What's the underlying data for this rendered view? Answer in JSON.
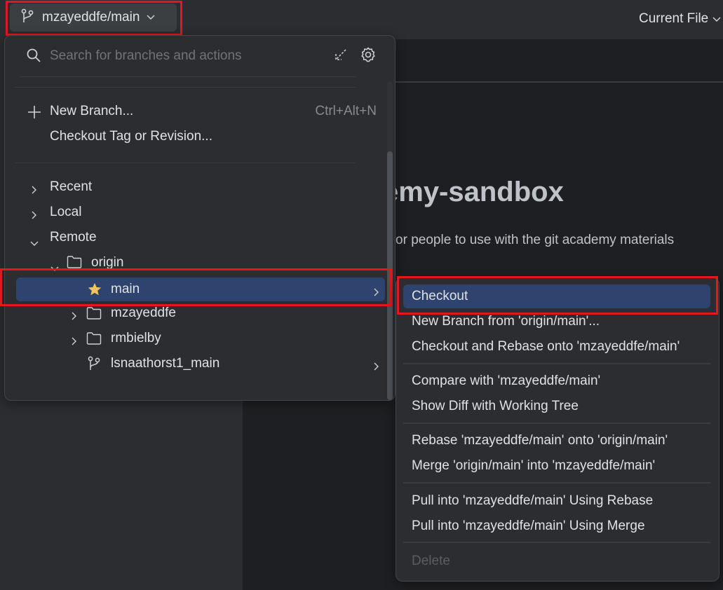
{
  "toolbar": {
    "branch_widget": {
      "label": "mzayeddfe/main",
      "icon": "git-branch-icon"
    },
    "run_config": {
      "label": "Current File"
    }
  },
  "editor": {
    "readme_title_partial": "emy-sandbox",
    "readme_text_partial": "y for people to use with the git academy materials"
  },
  "branch_popup": {
    "search": {
      "placeholder": "Search for branches and actions",
      "value": ""
    },
    "actions": [
      {
        "label": "New Branch...",
        "shortcut": "Ctrl+Alt+N",
        "icon": "plus-icon"
      },
      {
        "label": "Checkout Tag or Revision..."
      }
    ],
    "tree": [
      {
        "label": "Recent",
        "expanded": false,
        "level": 0
      },
      {
        "label": "Local",
        "expanded": false,
        "level": 0
      },
      {
        "label": "Remote",
        "expanded": true,
        "level": 0
      },
      {
        "label": "origin",
        "expanded": true,
        "level": 1,
        "icon": "folder-icon"
      },
      {
        "label": "main",
        "level": 2,
        "icon": "star-icon",
        "selected": true,
        "has_submenu": true
      },
      {
        "label": "mzayeddfe",
        "expanded": false,
        "level": 2,
        "icon": "folder-icon"
      },
      {
        "label": "rmbielby",
        "expanded": false,
        "level": 2,
        "icon": "folder-icon"
      },
      {
        "label": "lsnaathorst1_main",
        "level": 2,
        "icon": "git-branch-icon",
        "has_submenu": true
      }
    ]
  },
  "submenu": {
    "groups": [
      [
        {
          "label": "Checkout",
          "active": true
        },
        {
          "label": "New Branch from 'origin/main'..."
        },
        {
          "label": "Checkout and Rebase onto 'mzayeddfe/main'"
        }
      ],
      [
        {
          "label": "Compare with 'mzayeddfe/main'"
        },
        {
          "label": "Show Diff with Working Tree"
        }
      ],
      [
        {
          "label": "Rebase 'mzayeddfe/main' onto 'origin/main'"
        },
        {
          "label": "Merge 'origin/main' into 'mzayeddfe/main'"
        }
      ],
      [
        {
          "label": "Pull into 'mzayeddfe/main' Using Rebase"
        },
        {
          "label": "Pull into 'mzayeddfe/main' Using Merge"
        }
      ],
      [
        {
          "label": "Delete",
          "disabled": true
        }
      ]
    ]
  },
  "colors": {
    "selection": "#2e436e",
    "highlight_box": "#e0191e",
    "star": "#f2c55c"
  }
}
